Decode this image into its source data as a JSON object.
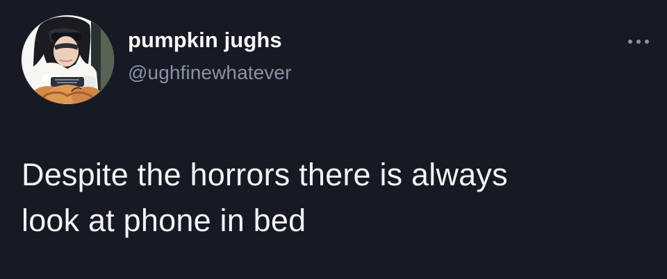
{
  "tweet": {
    "author": {
      "display_name": "pumpkin jughs",
      "handle": "@ughfinewhatever",
      "avatar_icon": "profile-photo"
    },
    "actions": {
      "more_icon": "more-options-icon"
    },
    "text_lines": [
      "Despite the horrors there is always",
      "look at phone in bed"
    ]
  },
  "colors": {
    "background": "#171a25",
    "primary_text": "#f3f4f6",
    "secondary_text": "#8a93a3"
  }
}
